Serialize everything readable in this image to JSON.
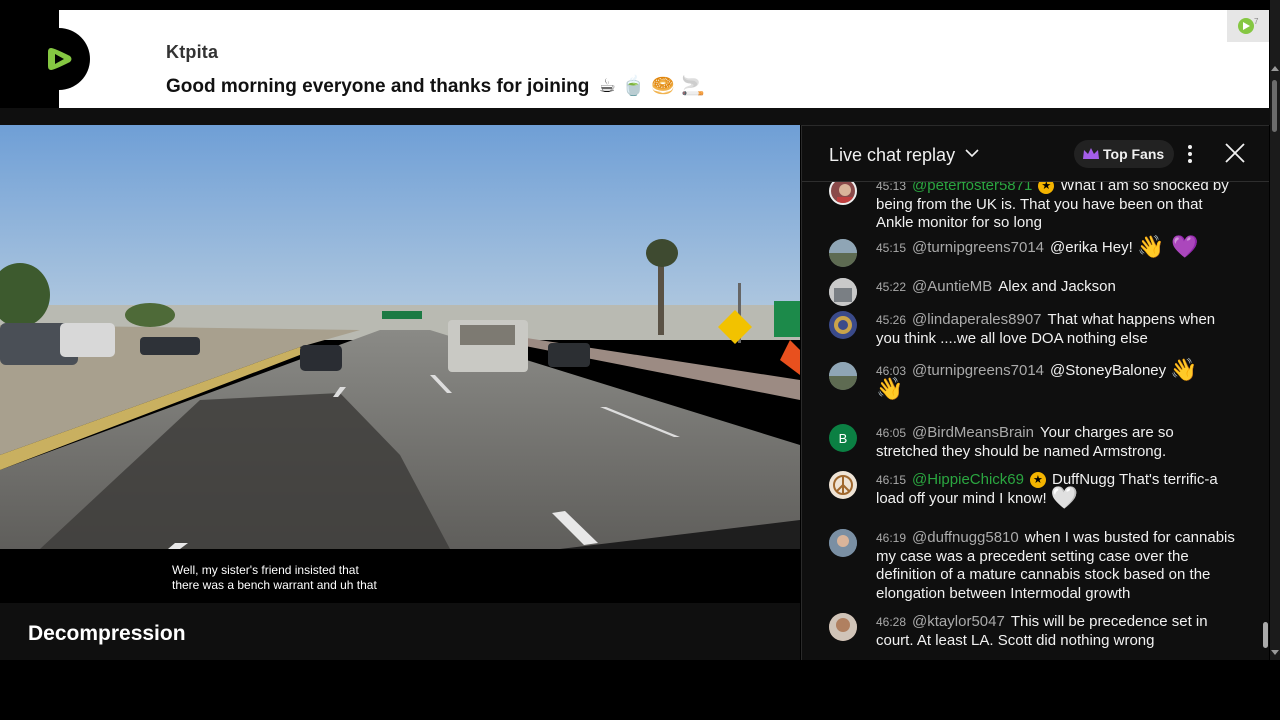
{
  "banner": {
    "user": "Ktpita",
    "message": "Good morning everyone and thanks for joining",
    "emojis": "☕ 🍵 🥯 🚬",
    "logo_icon": "rumble-play-icon",
    "accent": "#85c742"
  },
  "video": {
    "caption_line1": "Well, my sister's friend insisted that",
    "caption_line2": "there was a bench warrant and uh that",
    "title": "Decompression"
  },
  "chat": {
    "title": "Live chat replay",
    "top_fans_label": "Top Fans",
    "messages": [
      {
        "time": "45:13",
        "author": "@peterfoster5871",
        "member": true,
        "text": "What I am so shocked by being from the UK is. That you have been on that Ankle monitor for so long",
        "avatar_color": "#8a4a4a"
      },
      {
        "time": "45:15",
        "author": "@turnipgreens7014",
        "member": false,
        "text": "@erika Hey!",
        "emoji": "👋 💜",
        "avatar_color": "#6a7a7a"
      },
      {
        "time": "45:22",
        "author": "@AuntieMB",
        "member": false,
        "text": "Alex and Jackson",
        "avatar_color": "#9aa0a6"
      },
      {
        "time": "45:26",
        "author": "@lindaperales8907",
        "member": false,
        "text": "That what happens when you think ....we all love DOA nothing else",
        "avatar_color": "#3a4a8a"
      },
      {
        "time": "46:03",
        "author": "@turnipgreens7014",
        "member": false,
        "text": "@StoneyBaloney",
        "emoji": "👋",
        "emoji2": "👋",
        "avatar_color": "#6a7a7a"
      },
      {
        "time": "46:05",
        "author": "@BirdMeansBrain",
        "member": false,
        "text": "Your charges are so stretched they should be named Armstrong.",
        "avatar_letter": "B",
        "avatar_color": "#0b8043"
      },
      {
        "time": "46:15",
        "author": "@HippieChick69",
        "member": true,
        "text": "DuffNugg That's terrific-a load off your mind I know!",
        "emoji": "🤍",
        "avatar_color": "#c89a6a"
      },
      {
        "time": "46:19",
        "author": "@duffnugg5810",
        "member": false,
        "text": "when I was busted for cannabis my case was a precedent setting case over the definition of a mature cannabis stock based on the elongation between Intermodal growth",
        "avatar_color": "#4a6a8a"
      },
      {
        "time": "46:28",
        "author": "@ktaylor5047",
        "member": false,
        "text": "This will be precedence set in court. At least LA. Scott did nothing wrong",
        "avatar_color": "#8a6a5a"
      }
    ]
  }
}
